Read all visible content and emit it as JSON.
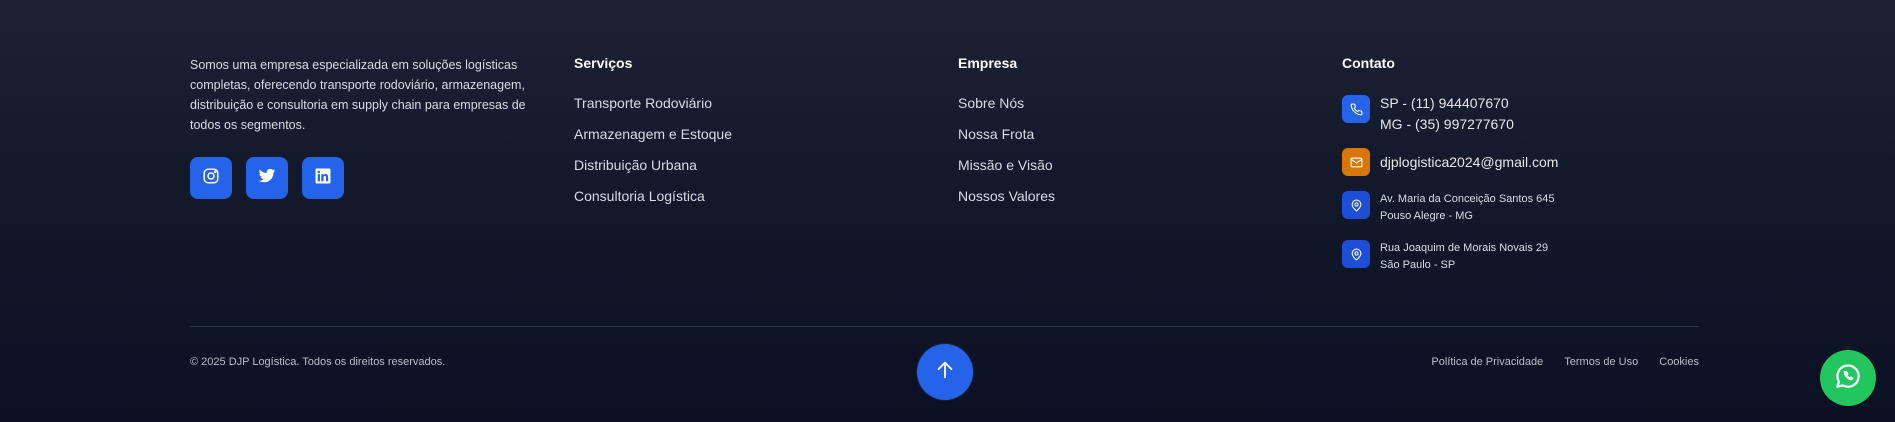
{
  "about": {
    "text": "Somos uma empresa especializada em soluções logísticas completas, oferecendo transporte rodoviário, armazenagem, distribuição e consultoria em supply chain para empresas de todos os segmentos."
  },
  "socials": [
    {
      "name": "instagram-icon"
    },
    {
      "name": "twitter-icon"
    },
    {
      "name": "linkedin-icon"
    }
  ],
  "services": {
    "title": "Serviços",
    "items": [
      "Transporte Rodoviário",
      "Armazenagem e Estoque",
      "Distribuição Urbana",
      "Consultoria Logística"
    ]
  },
  "company": {
    "title": "Empresa",
    "items": [
      "Sobre Nós",
      "Nossa Frota",
      "Missão e Visão",
      "Nossos Valores"
    ]
  },
  "contact": {
    "title": "Contato",
    "phone_sp": "SP - (11) 944407670",
    "phone_mg": "MG - (35) 997277670",
    "email": "djplogistica2024@gmail.com",
    "address1_line1": "Av. Maria da Conceição Santos 645",
    "address1_line2": "Pouso Alegre - MG",
    "address2_line1": "Rua Joaquim de Morais Novais 29",
    "address2_line2": "São Paulo - SP"
  },
  "bottom": {
    "copyright": "© 2025 DJP Logística. Todos os direitos reservados.",
    "privacy": "Política de Privacidade",
    "terms": "Termos de Uso",
    "cookies": "Cookies"
  },
  "colors": {
    "accent": "#2563eb",
    "email_icon": "#d97706",
    "whatsapp": "#22c55e"
  }
}
